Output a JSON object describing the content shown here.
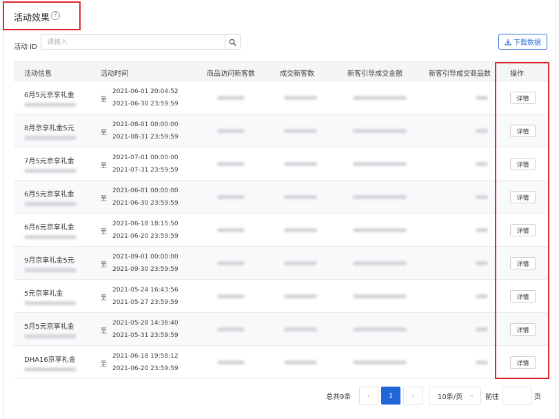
{
  "header": {
    "title": "活动效果",
    "help_glyph": "?"
  },
  "filter": {
    "label": "活动 ID",
    "placeholder": "请输入"
  },
  "toolbar": {
    "download_label": "下载数据"
  },
  "table": {
    "columns": [
      "活动信息",
      "活动时间",
      "商品访问新客数",
      "成交新客数",
      "新客引导成交金额",
      "新客引导成交商品数",
      "操作"
    ],
    "range_separator": "至",
    "detail_label": "详情",
    "rows": [
      {
        "name": "6月5元京享礼金",
        "start": "2021-06-01 20:04:52",
        "end": "2021-06-30 23:59:59"
      },
      {
        "name": "8月京享礼金5元",
        "start": "2021-08-01 00:00:00",
        "end": "2021-08-31 23:59:59"
      },
      {
        "name": "7月5元京享礼金",
        "start": "2021-07-01 00:00:00",
        "end": "2021-07-31 23:59:59"
      },
      {
        "name": "6月5元京享礼金",
        "start": "2021-06-01 00:00:00",
        "end": "2021-06-30 23:59:59"
      },
      {
        "name": "6月6元京享礼金",
        "start": "2021-06-18 18:15:50",
        "end": "2021-06-20 23:59:59"
      },
      {
        "name": "9月京享礼金5元",
        "start": "2021-09-01 00:00:00",
        "end": "2021-09-30 23:59:59"
      },
      {
        "name": "5元京享礼金",
        "start": "2021-05-24 16:43:56",
        "end": "2021-05-27 23:59:59"
      },
      {
        "name": "5月5元京享礼金",
        "start": "2021-05-28 14:36:40",
        "end": "2021-05-31 23:59:59"
      },
      {
        "name": "DHA16京享礼金",
        "start": "2021-06-18 19:58:12",
        "end": "2021-06-20 23:59:59"
      }
    ]
  },
  "pagination": {
    "total_label": "总共9条",
    "current_page": "1",
    "prev_glyph": "‹",
    "next_glyph": "›",
    "page_size": "10条/页",
    "goto_label": "前往",
    "page_unit": "页"
  },
  "colors": {
    "accent": "#1f66d8",
    "highlight_border": "#e0262e"
  }
}
